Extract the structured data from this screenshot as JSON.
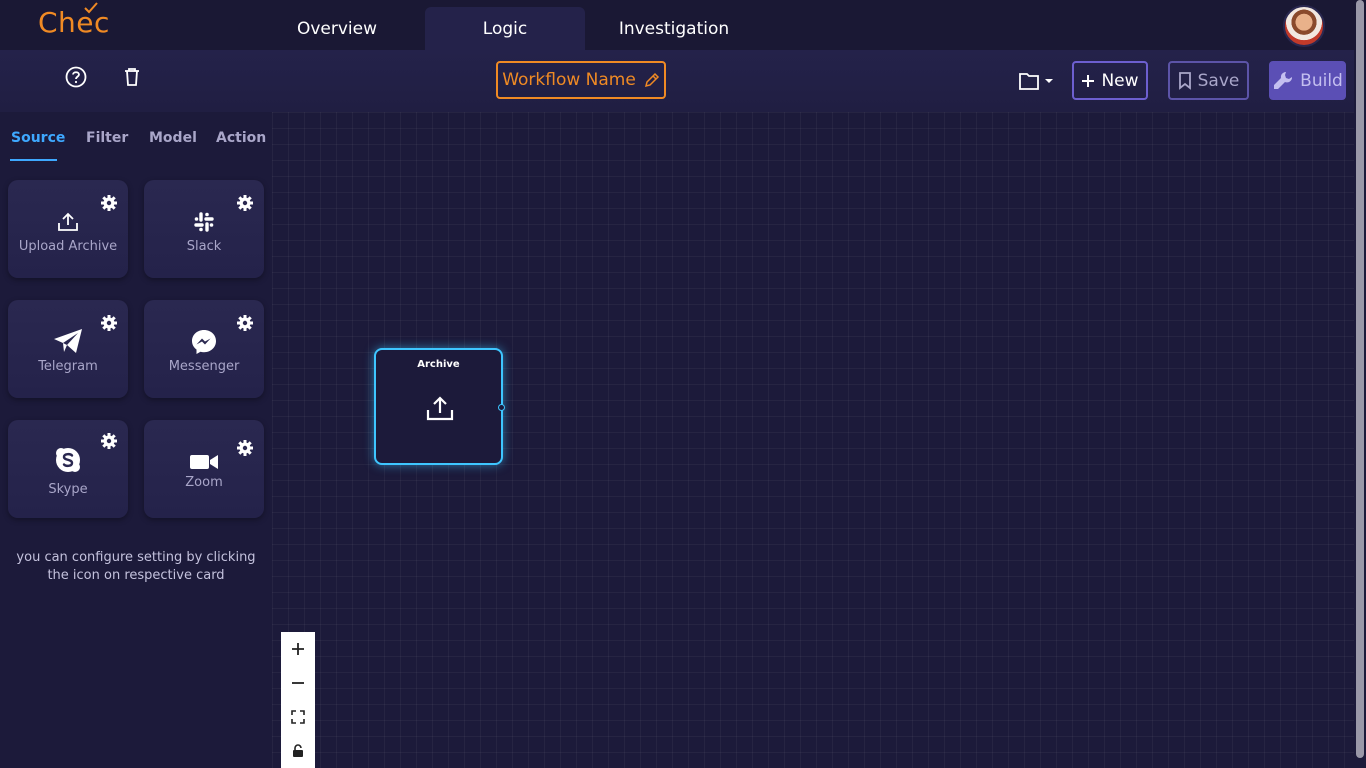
{
  "app": {
    "logo": "Chec"
  },
  "nav": {
    "tabs": [
      "Overview",
      "Logic",
      "Investigation"
    ],
    "active": "Logic"
  },
  "toolbar": {
    "workflow_name": "Workflow Name",
    "new_label": "New",
    "save_label": "Save",
    "build_label": "Build"
  },
  "sidebar": {
    "tabs": [
      "Source",
      "Filter",
      "Model",
      "Action"
    ],
    "active_tab": "Source",
    "cards": [
      {
        "label": "Upload Archive",
        "icon": "upload-icon"
      },
      {
        "label": "Slack",
        "icon": "slack-icon"
      },
      {
        "label": "Telegram",
        "icon": "telegram-icon"
      },
      {
        "label": "Messenger",
        "icon": "messenger-icon"
      },
      {
        "label": "Skype",
        "icon": "skype-icon"
      },
      {
        "label": "Zoom",
        "icon": "zoom-icon"
      }
    ],
    "hint": "you can configure setting by clicking the icon on respective card"
  },
  "canvas": {
    "nodes": [
      {
        "title": "Archive",
        "icon": "upload-icon"
      }
    ]
  },
  "colors": {
    "accent": "#f08a24",
    "primary": "#5b4fb5",
    "active_tab": "#3ea8ff",
    "node_border": "#3ec6ff",
    "background": "#1c1a3a"
  }
}
